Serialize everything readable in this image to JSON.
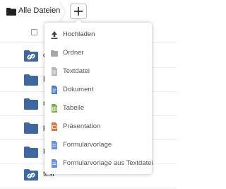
{
  "breadcrumb": {
    "home_label": "Alle Dateien",
    "home_icon": "folder-icon"
  },
  "toolbar": {
    "add_label": "+"
  },
  "files": [
    {
      "name": "o",
      "icon": "shared-folder-icon"
    },
    {
      "name": "D",
      "icon": "folder-icon"
    },
    {
      "name": "n",
      "icon": "folder-icon"
    },
    {
      "name": "p",
      "icon": "folder-icon"
    },
    {
      "name": "F",
      "icon": "folder-icon"
    },
    {
      "name": "test",
      "icon": "shared-folder-icon"
    }
  ],
  "new_menu": {
    "items": [
      {
        "label": "Hochladen",
        "icon": "upload-icon"
      },
      {
        "label": "Ordner",
        "icon": "folder-icon"
      },
      {
        "label": "Textdatei",
        "icon": "text-file-icon"
      },
      {
        "label": "Dokument",
        "icon": "document-icon"
      },
      {
        "label": "Tabelle",
        "icon": "spreadsheet-icon"
      },
      {
        "label": "Präsentation",
        "icon": "presentation-icon"
      },
      {
        "label": "Formularvorlage",
        "icon": "form-template-icon"
      },
      {
        "label": "Formularvorlage aus Textdatei",
        "icon": "form-template-icon"
      }
    ]
  },
  "colors": {
    "folder": "#3f68a0",
    "document": "#4b7dd1",
    "spreadsheet": "#7fb04b",
    "presentation": "#e0733c",
    "form": "#6c8fe0",
    "muted_icon": "#a7a7a7"
  }
}
